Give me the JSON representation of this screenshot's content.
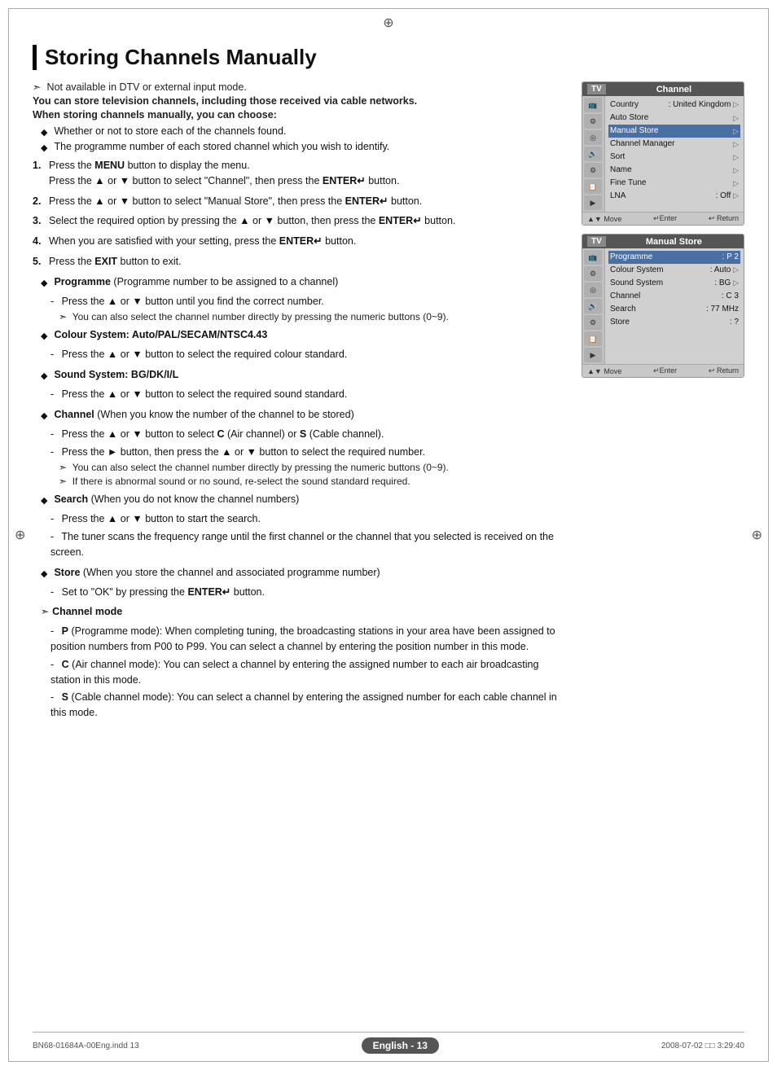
{
  "page": {
    "title": "Storing Channels Manually",
    "reg_mark": "⊕",
    "bottom_file": "BN68-01684A-00Eng.indd   13",
    "bottom_page_label": "English - 13",
    "bottom_date": "2008-07-02   □□   3:29:40"
  },
  "intro": {
    "note1": "Not available in DTV or external input mode.",
    "note2": "You can store television channels, including those received via cable networks.",
    "note3": "When storing channels manually, you can choose:"
  },
  "bullets": [
    "Whether or not to store each of the channels found.",
    "The programme number of each stored channel which you wish to identify."
  ],
  "steps": [
    {
      "num": "1.",
      "text": "Press the MENU button to display the menu.\nPress the ▲ or ▼ button to select \"Channel\", then press the ENTER↵ button."
    },
    {
      "num": "2.",
      "text": "Press the ▲ or ▼ button to select \"Manual Store\", then press the ENTER↵ button."
    },
    {
      "num": "3.",
      "text": "Select the required option by pressing the ▲ or ▼ button, then press the ENTER↵ button."
    },
    {
      "num": "4.",
      "text": "When you are satisfied with your setting, press the ENTER↵ button."
    },
    {
      "num": "5.",
      "text": "Press the EXIT button to exit."
    }
  ],
  "features": [
    {
      "title": "Programme",
      "title_normal": " (Programme number to be assigned to a channel)",
      "subs": [
        "Press the ▲ or ▼ button until you find the correct number.",
        "➣  You can also select the channel number directly by pressing the numeric buttons (0~9)."
      ]
    },
    {
      "title": "Colour System: Auto/PAL/SECAM/NTSC4.43",
      "title_normal": "",
      "subs": [
        "Press the ▲ or ▼ button to select the required colour standard."
      ]
    },
    {
      "title": "Sound System: BG/DK/I/L",
      "title_normal": "",
      "subs": [
        "Press the ▲ or ▼ button to select the required sound standard."
      ]
    },
    {
      "title": "Channel",
      "title_normal": " (When you know the number of the channel to be stored)",
      "subs": [
        "Press the ▲ or ▼ button to select C (Air channel) or S (Cable channel).",
        "Press the ► button, then press the ▲ or ▼ button to select the required number.",
        "➣  You can also select the channel number directly by pressing the numeric buttons (0~9).",
        "➣  If there is abnormal sound or no sound, re-select the sound standard required."
      ]
    },
    {
      "title": "Search",
      "title_normal": " (When you do not know the channel numbers)",
      "subs": [
        "Press the ▲ or ▼ button to start the search.",
        "The tuner scans the frequency range until the first channel or the channel that you selected is received on the screen."
      ]
    },
    {
      "title": "Store",
      "title_normal": " (When you store the channel and associated programme number)",
      "subs": [
        "Set to \"OK\" by pressing the ENTER↵ button."
      ]
    },
    {
      "title": "Channel mode",
      "title_normal": "",
      "is_note": true,
      "subs": [
        "P (Programme mode): When completing tuning, the broadcasting stations in your area have been assigned to position numbers from P00 to P99. You can select a channel by entering the position number in this mode.",
        "C (Air channel mode): You can select a channel by entering the assigned number to each air broadcasting station in this mode.",
        "S (Cable channel mode): You can select a channel by entering the assigned number for each cable channel in this mode."
      ]
    }
  ],
  "panel1": {
    "tv_label": "TV",
    "header_title": "Channel",
    "menu_items": [
      {
        "label": "Country",
        "value": ": United Kingdom",
        "arrow": "▷",
        "highlighted": false
      },
      {
        "label": "Auto Store",
        "value": "",
        "arrow": "▷",
        "highlighted": false
      },
      {
        "label": "Manual Store",
        "value": "",
        "arrow": "▷",
        "highlighted": true
      },
      {
        "label": "Channel Manager",
        "value": "",
        "arrow": "▷",
        "highlighted": false
      },
      {
        "label": "Sort",
        "value": "",
        "arrow": "▷",
        "highlighted": false
      },
      {
        "label": "Name",
        "value": "",
        "arrow": "▷",
        "highlighted": false
      },
      {
        "label": "Fine Tune",
        "value": "",
        "arrow": "▷",
        "highlighted": false
      },
      {
        "label": "LNA",
        "value": ": Off",
        "arrow": "▷",
        "highlighted": false
      }
    ],
    "footer": {
      "move": "▲▼ Move",
      "enter": "↵Enter",
      "return": "↩ Return"
    }
  },
  "panel2": {
    "tv_label": "TV",
    "header_title": "Manual Store",
    "menu_items": [
      {
        "label": "Programme",
        "value": ": P 2",
        "arrow": "",
        "highlighted": true
      },
      {
        "label": "Colour System",
        "value": ": Auto",
        "arrow": "▷",
        "highlighted": false
      },
      {
        "label": "Sound System",
        "value": ": BG",
        "arrow": "▷",
        "highlighted": false
      },
      {
        "label": "Channel",
        "value": ": C 3",
        "arrow": "",
        "highlighted": false
      },
      {
        "label": "Search",
        "value": ": 77 MHz",
        "arrow": "",
        "highlighted": false
      },
      {
        "label": "Store",
        "value": ": ?",
        "arrow": "",
        "highlighted": false
      }
    ],
    "footer": {
      "move": "▲▼ Move",
      "enter": "↵Enter",
      "return": "↩ Return"
    }
  }
}
